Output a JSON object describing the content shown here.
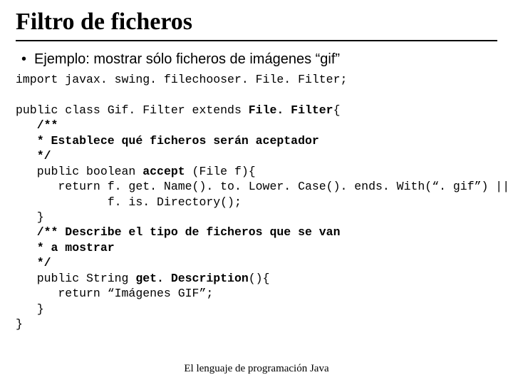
{
  "title": "Filtro de ficheros",
  "bullet": "Ejemplo: mostrar sólo ficheros de imágenes “gif”",
  "code": {
    "l01a": "import javax. swing. filechooser. File. Filter;",
    "l02a": "public class Gif. Filter extends ",
    "l02b": "File. Filter",
    "l02c": "{",
    "l03": "   /**",
    "l04": "   * Establece qué ficheros serán aceptador",
    "l05": "   */",
    "l06a": "   public boolean ",
    "l06b": "accept",
    "l06c": " (File f){",
    "l07": "      return f. get. Name(). to. Lower. Case(). ends. With(“. gif”) ||",
    "l08": "             f. is. Directory();",
    "l09": "   }",
    "l10": "   /** Describe el tipo de ficheros que se van",
    "l11": "   * a mostrar",
    "l12": "   */",
    "l13a": "   public String ",
    "l13b": "get. Description",
    "l13c": "(){",
    "l14": "      return “Imágenes GIF”;",
    "l15": "   }",
    "l16": "}"
  },
  "footer": "El lenguaje de programación Java"
}
